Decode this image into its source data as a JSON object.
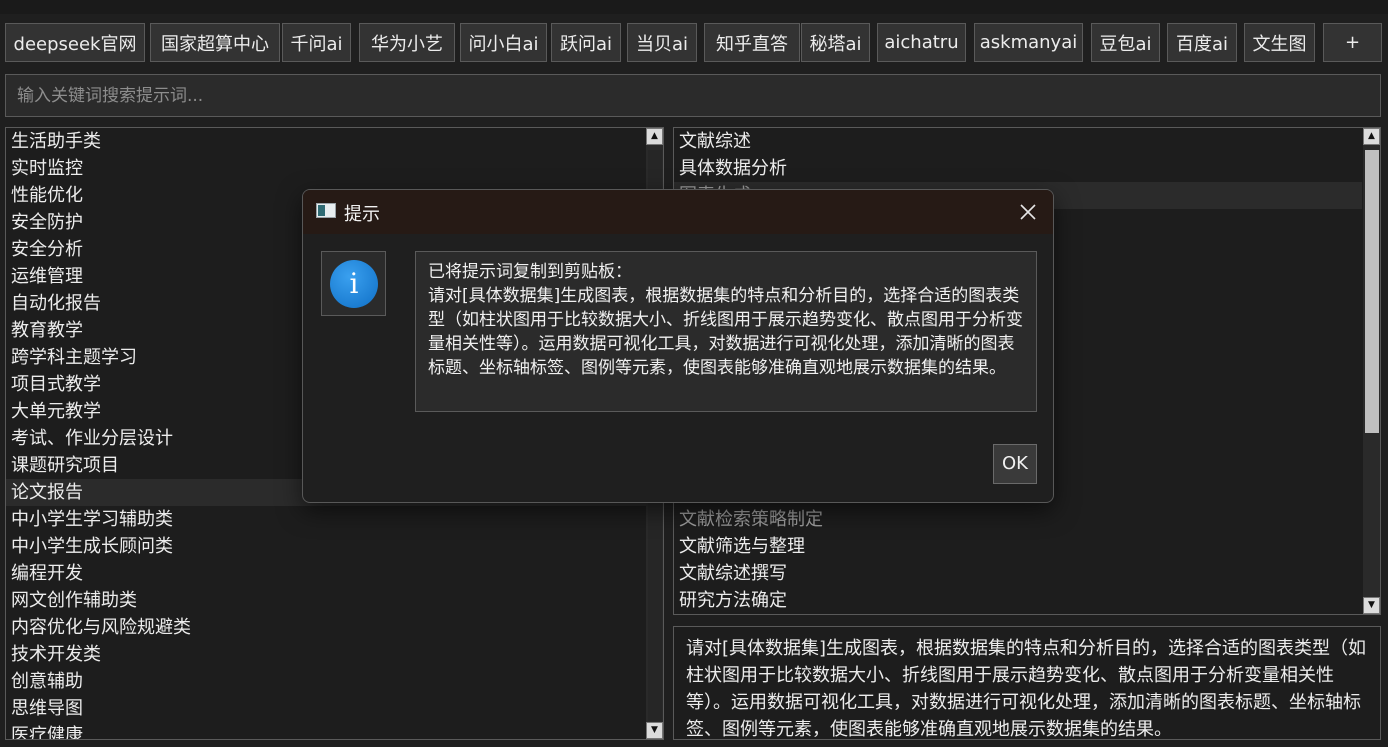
{
  "toolbar": {
    "tabs": [
      "deepseek官网",
      "国家超算中心",
      "千问ai",
      "华为小艺",
      "问小白ai",
      "跃问ai",
      "当贝ai",
      "知乎直答",
      "秘塔ai",
      "aichatru",
      "askmanyai",
      "豆包ai",
      "百度ai",
      "文生图",
      "+"
    ]
  },
  "search": {
    "placeholder": "输入关键词搜索提示词..."
  },
  "categories": {
    "items": [
      "生活助手类",
      "实时监控",
      "性能优化",
      "安全防护",
      "安全分析",
      "运维管理",
      "自动化报告",
      "教育教学",
      "跨学科主题学习",
      "项目式教学",
      "大单元教学",
      "考试、作业分层设计",
      "课题研究项目",
      "论文报告",
      "中小学生学习辅助类",
      "中小学生成长顾问类",
      "编程开发",
      "网文创作辅助类",
      "内容优化与风险规避类",
      "技术开发类",
      "创意辅助",
      "思维导图",
      "医疗健康"
    ],
    "selected": "论文报告"
  },
  "prompts": {
    "items": [
      "文献综述",
      "具体数据分析",
      "图表生成",
      "",
      "",
      "",
      "",
      "",
      "",
      "",
      "",
      "",
      "",
      "",
      "文献检索策略制定",
      "文献筛选与整理",
      "文献综述撰写",
      "研究方法确定"
    ],
    "selected": "图表生成"
  },
  "description": {
    "text": "请对[具体数据集]生成图表，根据数据集的特点和分析目的，选择合适的图表类型（如柱状图用于比较数据大小、折线图用于展示趋势变化、散点图用于分析变量相关性等）。运用数据可视化工具，对数据进行可视化处理，添加清晰的图表标题、坐标轴标签、图例等元素，使图表能够准确直观地展示数据集的结果。"
  },
  "dialog": {
    "title": "提示",
    "message": "已将提示词复制到剪贴板：\n请对[具体数据集]生成图表，根据数据集的特点和分析目的，选择合适的图表类型（如柱状图用于比较数据大小、折线图用于展示趋势变化、散点图用于分析变量相关性等）。运用数据可视化工具，对数据进行可视化处理，添加清晰的图表标题、坐标轴标签、图例等元素，使图表能够准确直观地展示数据集的结果。",
    "ok_label": "OK",
    "icon": "information-icon",
    "icon_glyph": "i"
  },
  "colors": {
    "info_blue": "#1a7fd8",
    "title_bar": "#261a15",
    "background": "#1f1f1f"
  }
}
